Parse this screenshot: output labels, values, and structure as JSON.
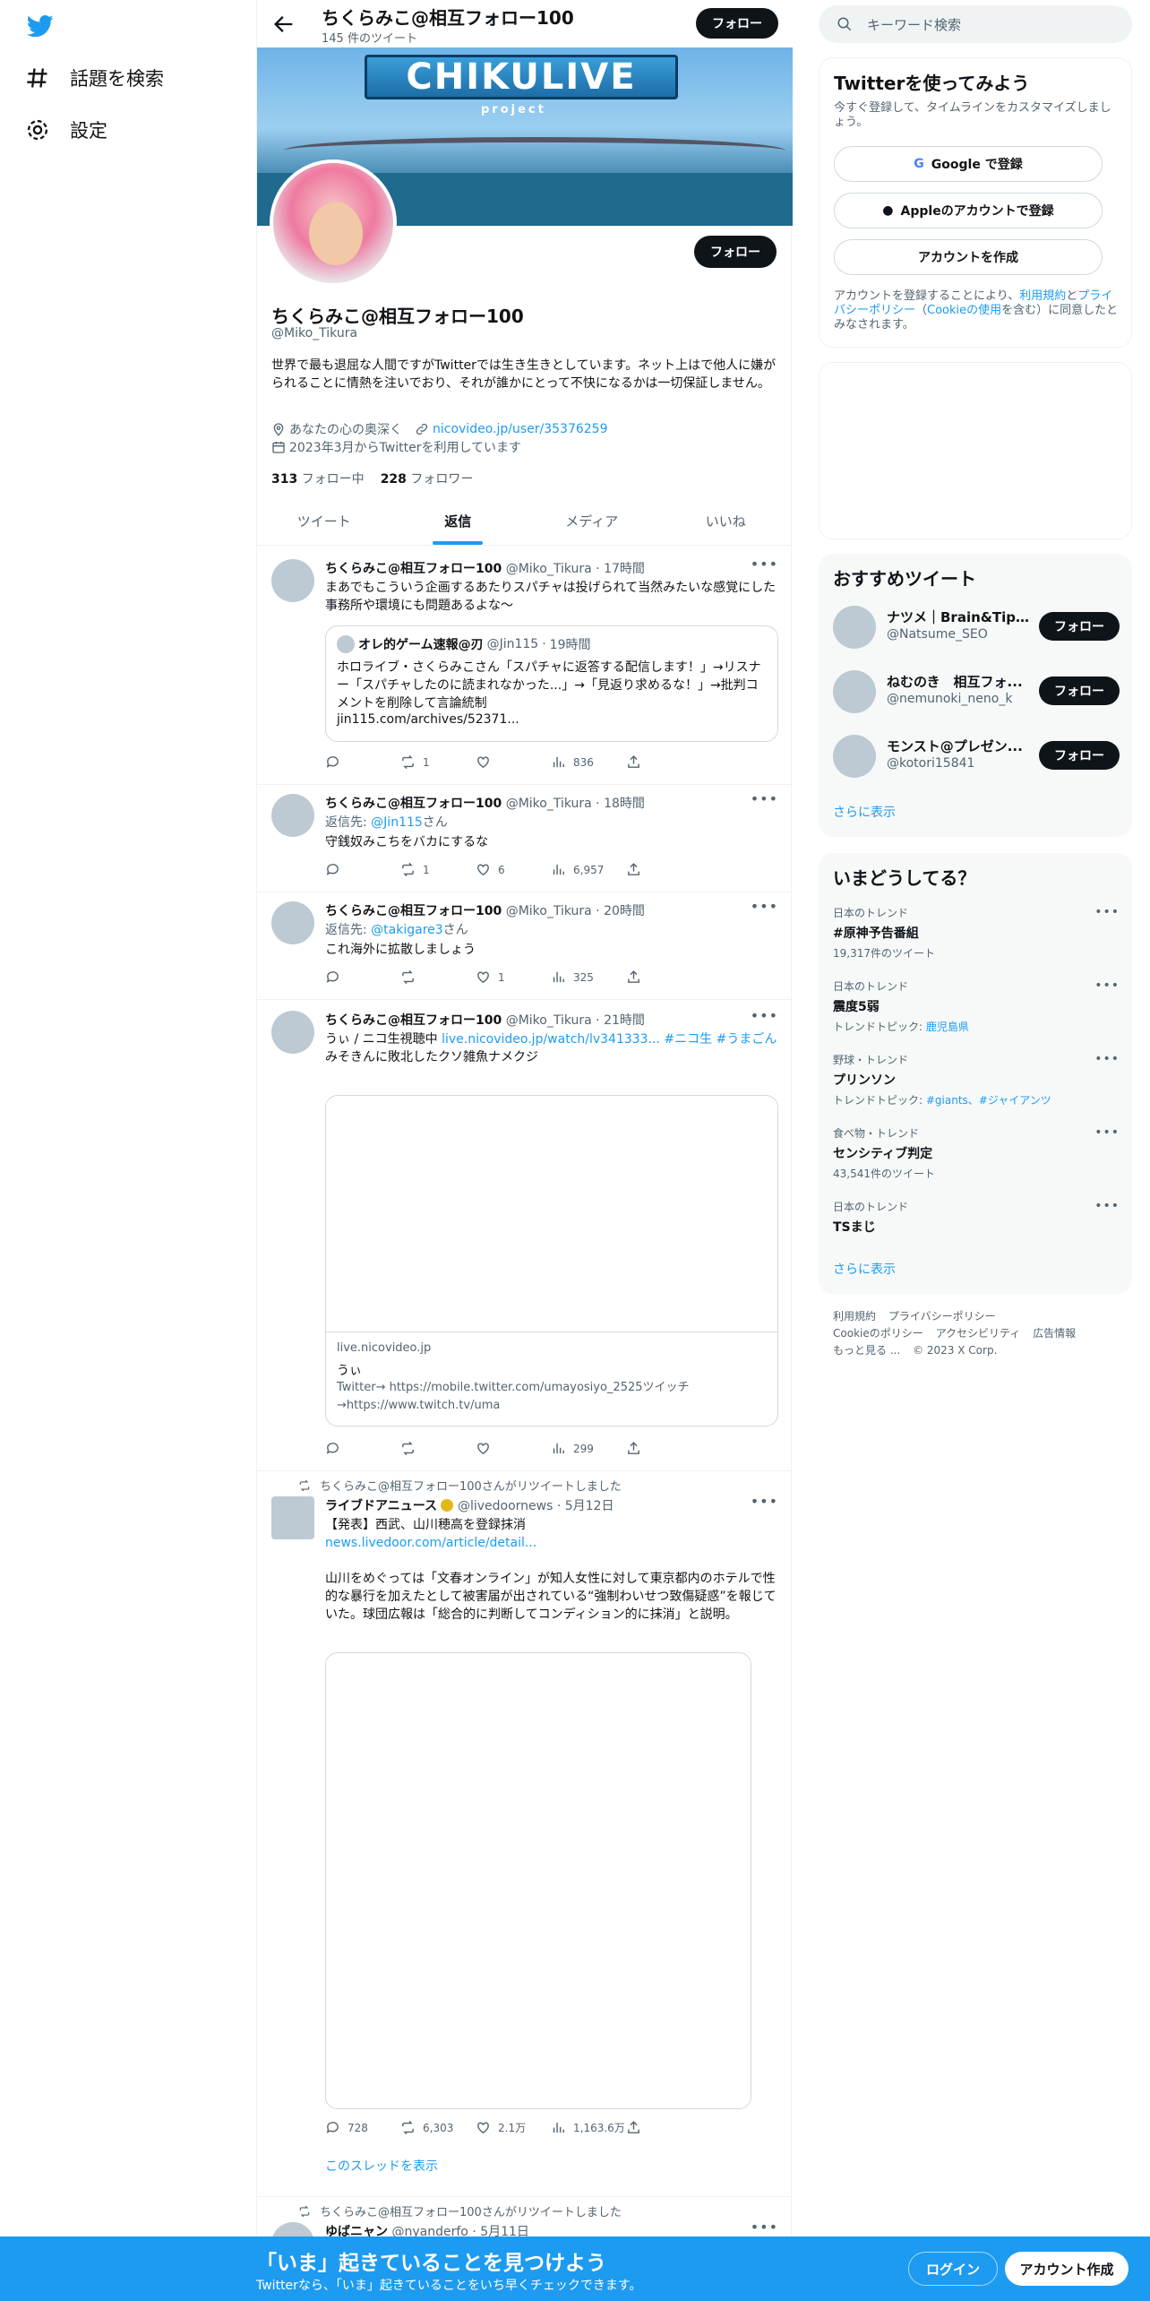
{
  "leftnav": {
    "explore_label": "話題を検索",
    "settings_label": "設定"
  },
  "topbar": {
    "name": "ちくらみこ@相互フォロー100",
    "tweet_count": "145 件のツイート",
    "follow_label": "フォロー"
  },
  "banner": {
    "title": "CHIKULIVE",
    "subtitle": "project"
  },
  "profile": {
    "follow_label": "フォロー",
    "name": "ちくらみこ@相互フォロー100",
    "handle": "@Miko_Tikura",
    "bio": "世界で最も退屈な人間ですがTwitterでは生き生きとしています。ネット上はで他人に嫌がられることに情熱を注いでおり、それが誰かにとって不快になるかは一切保証しません。",
    "location": "あなたの心の奥深く",
    "website": "nicovideo.jp/user/35376259",
    "joined": "2023年3月からTwitterを利用しています",
    "following_count": "313",
    "following_label": "フォロー中",
    "followers_count": "228",
    "followers_label": "フォロワー"
  },
  "tabs": [
    "ツイート",
    "返信",
    "メディア",
    "いいね"
  ],
  "tweets": [
    {
      "name": "ちくらみこ@相互フォロー100",
      "handle": "@Miko_Tikura",
      "time": "17時間",
      "text": "まあでもこういう企画するあたりスパチャは投げられて当然みたいな感覚にした事務所や環境にも問題あるよな～",
      "quote": {
        "name": "オレ的ゲーム速報@刃",
        "handle": "@Jin115",
        "time": "19時間",
        "text": "ホロライブ・さくらみこさん「スパチャに返答する配信します！」→リスナー「スパチャしたのに読まれなかった...」→「見返り求めるな！」→批判コメントを削除して言論統制",
        "link": "jin115.com/archives/52371..."
      },
      "replies": "",
      "retweets": "1",
      "likes": "",
      "views": "836"
    },
    {
      "name": "ちくらみこ@相互フォロー100",
      "handle": "@Miko_Tikura",
      "time": "18時間",
      "reply_to_prefix": "返信先:",
      "reply_to": "@Jin115",
      "reply_to_suffix": "さん",
      "text": "守銭奴みこちをバカにするな",
      "replies": "",
      "retweets": "1",
      "likes": "6",
      "views": "6,957"
    },
    {
      "name": "ちくらみこ@相互フォロー100",
      "handle": "@Miko_Tikura",
      "time": "20時間",
      "reply_to_prefix": "返信先:",
      "reply_to": "@takigare3",
      "reply_to_suffix": "さん",
      "text": "これ海外に拡散しましょう",
      "replies": "",
      "retweets": "",
      "likes": "1",
      "views": "325"
    },
    {
      "name": "ちくらみこ@相互フォロー100",
      "handle": "@Miko_Tikura",
      "time": "21時間",
      "text_prefix": "うぃ / ニコ生視聴中",
      "text_link": "live.nicovideo.jp/watch/lv341333...",
      "text_tags": "#ニコ生 #うまごん",
      "text_line2": "みそきんに敗北したクソ雑魚ナメクジ",
      "card": {
        "domain": "live.nicovideo.jp",
        "title": "うぃ",
        "desc": "Twitter→ https://mobile.twitter.com/umayosiyo_2525ツイッチ→https://www.twitch.tv/uma"
      },
      "replies": "",
      "retweets": "",
      "likes": "",
      "views": "299"
    },
    {
      "retweeted_by": "ちくらみこ@相互フォロー100さんがリツイートしました",
      "name": "ライブドアニュース",
      "handle": "@livedoornews",
      "time": "5月12日",
      "text_line1": "【発表】西武、山川穂高を登録抹消",
      "text_link": "news.livedoor.com/article/detail...",
      "text_body": "山川をめぐっては「文春オンライン」が知人女性に対して東京都内のホテルで性的な暴行を加えたとして被害届が出されている“強制わいせつ致傷疑惑”を報じていた。球団広報は「総合的に判断してコンディション的に抹消」と説明。",
      "replies": "728",
      "retweets": "6,303",
      "likes": "2.1万",
      "views": "1,163.6万",
      "show_thread": "このスレッドを表示"
    },
    {
      "retweeted_by": "ちくらみこ@相互フォロー100さんがリツイートしました",
      "name": "ゆばニャン",
      "handle": "@nyanderfo",
      "time": "5月11日"
    }
  ],
  "right": {
    "search_placeholder": "キーワード検索",
    "signup": {
      "title": "Twitterを使ってみよう",
      "desc": "今すぐ登録して、タイムラインをカスタマイズしましょう。",
      "google": "Google で登録",
      "apple": "Appleのアカウントで登録",
      "create": "アカウントを作成",
      "legal_prefix": "アカウントを登録することにより、",
      "legal_terms": "利用規約",
      "legal_and": "と",
      "legal_privacy": "プライバシーポリシー",
      "legal_paren_open": "（",
      "legal_cookie": "Cookieの使用",
      "legal_suffix": "を含む）に同意したとみなされます。"
    },
    "who_to_follow": {
      "title": "おすすめツイート",
      "follow_label": "フォロー",
      "users": [
        {
          "name": "ナツメ｜Brain&Tips...",
          "handle": "@Natsume_SEO"
        },
        {
          "name": "ねむのき　相互フォ...",
          "handle": "@nemunoki_neno_k"
        },
        {
          "name": "モンスト@プレゼン...",
          "handle": "@kotori15841"
        }
      ],
      "show_more": "さらに表示"
    },
    "trends": {
      "title": "いまどうしてる？",
      "items": [
        {
          "meta": "日本のトレンド",
          "name": "#原神予告番組",
          "sub": "19,317件のツイート"
        },
        {
          "meta": "日本のトレンド",
          "name": "震度5弱",
          "sub_prefix": "トレンドトピック: ",
          "sub_link": "鹿児島県"
        },
        {
          "meta": "野球・トレンド",
          "name": "プリンソン",
          "sub_prefix": "トレンドトピック: ",
          "sub_link": "#giants、#ジャイアンツ"
        },
        {
          "meta": "食べ物・トレンド",
          "name": "センシティブ判定",
          "sub": "43,541件のツイート"
        },
        {
          "meta": "日本のトレンド",
          "name": "TSまじ"
        }
      ],
      "show_more": "さらに表示"
    },
    "footer": {
      "terms": "利用規約",
      "privacy": "プライバシーポリシー",
      "cookie": "Cookieのポリシー",
      "accessibility": "アクセシビリティ",
      "ads": "広告情報",
      "more": "もっと見る ...",
      "copyright": "© 2023 X Corp."
    }
  },
  "bottombar": {
    "title": "「いま」起きていることを見つけよう",
    "subtitle": "Twitterなら、「いま」起きていることをいち早くチェックできます。",
    "login": "ログイン",
    "signup": "アカウント作成"
  },
  "colors": {
    "accent": "#1d9bf0",
    "text": "#0f1419",
    "muted": "#536471"
  }
}
